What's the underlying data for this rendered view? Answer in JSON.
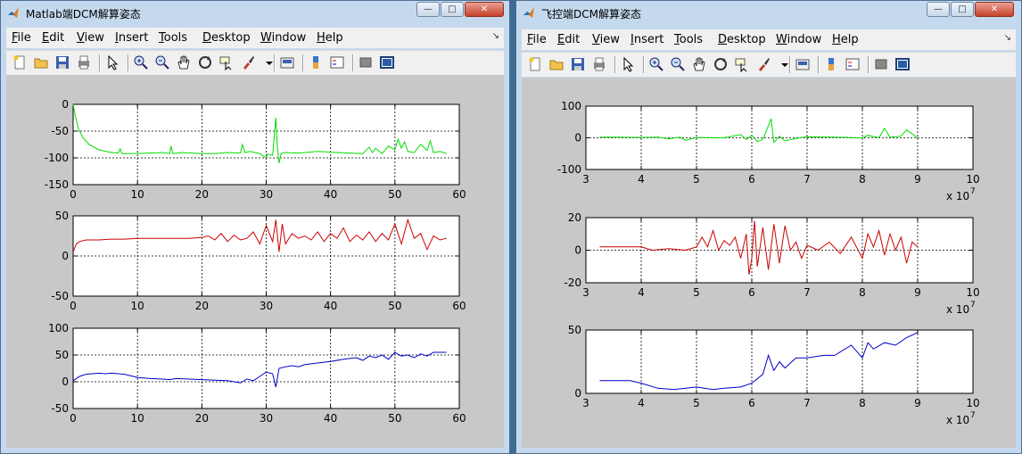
{
  "menus": [
    {
      "first": "F",
      "rest": "ile"
    },
    {
      "first": "E",
      "rest": "dit"
    },
    {
      "first": "V",
      "rest": "iew"
    },
    {
      "first": "I",
      "rest": "nsert"
    },
    {
      "first": "T",
      "rest": "ools"
    },
    {
      "first": "D",
      "rest": "esktop"
    },
    {
      "first": "W",
      "rest": "indow"
    },
    {
      "first": "H",
      "rest": "elp"
    }
  ],
  "toolbar_icons": [
    "new-figure-icon",
    "open-file-icon",
    "save-icon",
    "print-icon",
    "|",
    "select-arrow-icon",
    "|",
    "zoom-in-icon",
    "zoom-out-icon",
    "pan-hand-icon",
    "rotate-3d-icon",
    "data-cursor-icon",
    "brush-icon",
    "dropdown-arrow-icon",
    "|",
    "link-plot-icon",
    "|",
    "colorbar-icon",
    "legend-icon",
    "|",
    "hide-plot-tools-icon",
    "show-plot-tools-icon"
  ],
  "window_controls": {
    "minimize": "—",
    "maximize": "□",
    "close": "✕"
  },
  "left_window": {
    "title": "Matlab端DCM解算姿态",
    "chart_data": [
      {
        "type": "line",
        "color": "#00dd00",
        "xlim": [
          0,
          60
        ],
        "ylim": [
          -150,
          0
        ],
        "xticks": [
          "0",
          "10",
          "20",
          "30",
          "40",
          "50",
          "60"
        ],
        "yticks": [
          "0",
          "-50",
          "-100",
          "-150"
        ],
        "x": [
          0,
          0.3,
          0.8,
          1.5,
          2.5,
          4,
          6,
          7,
          7.3,
          7.6,
          9,
          12,
          14,
          15,
          15.2,
          15.5,
          17,
          20,
          22,
          24,
          26,
          26.3,
          26.7,
          27.5,
          29,
          30,
          30.2,
          31,
          31.5,
          31.7,
          32,
          32.3,
          33,
          35,
          38,
          41,
          43,
          45,
          46,
          46.5,
          47,
          48,
          49,
          50,
          50.5,
          51,
          51.5,
          52,
          53,
          54,
          55,
          55.5,
          56,
          57,
          58
        ],
        "y": [
          0,
          -20,
          -45,
          -62,
          -75,
          -85,
          -90,
          -91,
          -83,
          -92,
          -92,
          -91,
          -90,
          -92,
          -78,
          -92,
          -90,
          -92,
          -92,
          -90,
          -91,
          -75,
          -90,
          -88,
          -92,
          -100,
          -93,
          -95,
          -25,
          -75,
          -110,
          -92,
          -90,
          -91,
          -88,
          -90,
          -91,
          -92,
          -80,
          -90,
          -82,
          -92,
          -78,
          -85,
          -65,
          -82,
          -70,
          -88,
          -90,
          -75,
          -86,
          -68,
          -90,
          -88,
          -92
        ]
      },
      {
        "type": "line",
        "color": "#cc0000",
        "xlim": [
          0,
          60
        ],
        "ylim": [
          -50,
          50
        ],
        "xticks": [
          "0",
          "10",
          "20",
          "30",
          "40",
          "50",
          "60"
        ],
        "yticks": [
          "50",
          "0",
          "-50"
        ],
        "x": [
          0,
          0.5,
          1,
          2,
          4,
          6,
          8,
          10,
          12,
          15,
          18,
          20,
          21,
          22,
          23,
          24,
          25,
          26,
          27,
          28,
          29,
          30,
          31,
          31.5,
          32,
          32.5,
          33,
          34,
          35,
          36,
          37,
          38,
          39,
          40,
          41,
          42,
          43,
          44,
          45,
          46,
          47,
          48,
          49,
          50,
          51,
          52,
          53,
          54,
          55,
          56,
          57,
          58
        ],
        "y": [
          5,
          15,
          18,
          20,
          20,
          21,
          21,
          22,
          22,
          22,
          22,
          23,
          25,
          20,
          28,
          18,
          26,
          20,
          22,
          30,
          15,
          38,
          18,
          45,
          5,
          40,
          15,
          28,
          22,
          25,
          20,
          30,
          18,
          28,
          22,
          35,
          18,
          26,
          20,
          30,
          18,
          28,
          20,
          40,
          15,
          45,
          22,
          28,
          8,
          25,
          20,
          22
        ]
      },
      {
        "type": "line",
        "color": "#0000cc",
        "xlim": [
          0,
          60
        ],
        "ylim": [
          -50,
          100
        ],
        "xticks": [
          "0",
          "10",
          "20",
          "30",
          "40",
          "50",
          "60"
        ],
        "yticks": [
          "100",
          "50",
          "0",
          "-50"
        ],
        "x": [
          0,
          1,
          2,
          3,
          4,
          5,
          6,
          8,
          10,
          12,
          14,
          15,
          16,
          18,
          20,
          22,
          24,
          25,
          26,
          27,
          28,
          29,
          30,
          31,
          31.5,
          32,
          33,
          34,
          35,
          36,
          38,
          40,
          42,
          44,
          45,
          46,
          47,
          48,
          49,
          50,
          51,
          52,
          53,
          54,
          55,
          56,
          58
        ],
        "y": [
          2,
          10,
          14,
          15,
          16,
          15,
          16,
          14,
          8,
          6,
          5,
          4,
          6,
          5,
          4,
          3,
          2,
          0,
          -2,
          5,
          2,
          10,
          18,
          15,
          -10,
          25,
          28,
          30,
          28,
          32,
          35,
          38,
          42,
          45,
          40,
          48,
          45,
          50,
          42,
          55,
          48,
          50,
          45,
          52,
          48,
          55,
          55
        ]
      }
    ]
  },
  "right_window": {
    "title": "飞控端DCM解算姿态",
    "exponent_label": "x 10",
    "exponent_power": "7",
    "chart_data": [
      {
        "type": "line",
        "color": "#00dd00",
        "xlim": [
          3,
          10
        ],
        "ylim": [
          -100,
          100
        ],
        "xticks": [
          "3",
          "4",
          "5",
          "6",
          "7",
          "8",
          "9",
          "10"
        ],
        "yticks": [
          "100",
          "0",
          "-100"
        ],
        "x": [
          3.25,
          3.5,
          4,
          4.3,
          4.5,
          4.7,
          4.8,
          5,
          5.5,
          5.8,
          5.9,
          6,
          6.1,
          6.2,
          6.35,
          6.4,
          6.5,
          6.6,
          6.8,
          7,
          7.5,
          8,
          8.1,
          8.3,
          8.4,
          8.5,
          8.7,
          8.8,
          9
        ],
        "y": [
          2,
          2,
          1,
          2,
          -3,
          2,
          -8,
          1,
          0,
          10,
          -5,
          8,
          -12,
          -5,
          60,
          -15,
          5,
          -10,
          -2,
          3,
          2,
          0,
          8,
          0,
          30,
          2,
          5,
          25,
          0
        ]
      },
      {
        "type": "line",
        "color": "#cc0000",
        "xlim": [
          3,
          10
        ],
        "ylim": [
          -20,
          20
        ],
        "xticks": [
          "3",
          "4",
          "5",
          "6",
          "7",
          "8",
          "9",
          "10"
        ],
        "yticks": [
          "20",
          "0",
          "-20"
        ],
        "x": [
          3.25,
          3.5,
          4,
          4.2,
          4.5,
          4.8,
          5,
          5.1,
          5.2,
          5.3,
          5.4,
          5.5,
          5.6,
          5.7,
          5.8,
          5.9,
          5.95,
          6,
          6.05,
          6.1,
          6.2,
          6.3,
          6.4,
          6.5,
          6.6,
          6.7,
          6.8,
          6.9,
          7,
          7.2,
          7.4,
          7.6,
          7.8,
          8,
          8.1,
          8.2,
          8.3,
          8.4,
          8.5,
          8.6,
          8.7,
          8.8,
          8.9,
          9
        ],
        "y": [
          2,
          2,
          2,
          0,
          1,
          0,
          2,
          8,
          2,
          12,
          0,
          6,
          3,
          8,
          -5,
          10,
          -15,
          -5,
          18,
          -10,
          14,
          -12,
          16,
          -8,
          15,
          0,
          5,
          -5,
          3,
          0,
          5,
          -2,
          8,
          -5,
          10,
          2,
          12,
          -3,
          10,
          0,
          8,
          -8,
          5,
          2
        ]
      },
      {
        "type": "line",
        "color": "#0000cc",
        "xlim": [
          3,
          10
        ],
        "ylim": [
          0,
          50
        ],
        "xticks": [
          "3",
          "4",
          "5",
          "6",
          "7",
          "8",
          "9",
          "10"
        ],
        "yticks": [
          "50",
          "0"
        ],
        "x": [
          3.25,
          3.5,
          3.8,
          4,
          4.3,
          4.6,
          5,
          5.3,
          5.5,
          5.8,
          6,
          6.2,
          6.3,
          6.4,
          6.5,
          6.6,
          6.8,
          7,
          7.3,
          7.5,
          7.8,
          8,
          8.1,
          8.2,
          8.4,
          8.6,
          8.8,
          9
        ],
        "y": [
          10,
          10,
          10,
          8,
          4,
          3,
          5,
          3,
          4,
          5,
          8,
          15,
          30,
          18,
          25,
          20,
          28,
          28,
          30,
          30,
          38,
          28,
          40,
          35,
          40,
          38,
          44,
          48
        ]
      }
    ]
  }
}
